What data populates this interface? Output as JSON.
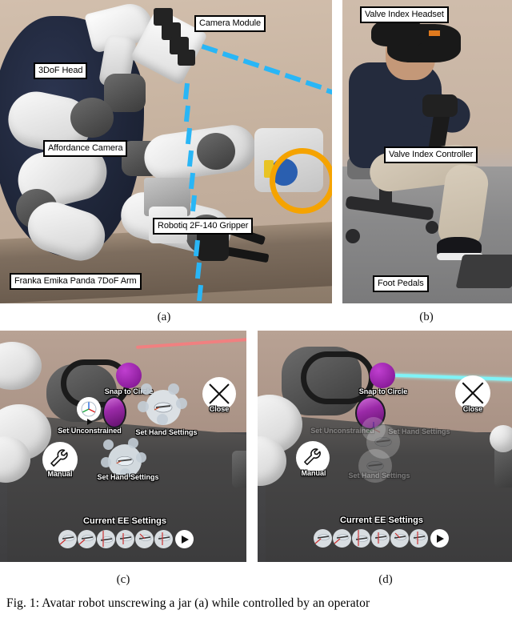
{
  "figure": {
    "caption": "Fig. 1: Avatar robot unscrewing a jar (a) while controlled by an operator",
    "subcaptions": [
      "(a)",
      "(b)",
      "(c)",
      "(d)"
    ]
  },
  "panel_a": {
    "name": "avatar-robot-hardware-photo",
    "annotations": [
      {
        "id": "camera-module",
        "text": "Camera Module"
      },
      {
        "id": "3dof-head",
        "text": "3DoF Head"
      },
      {
        "id": "affordance-camera",
        "text": "Affordance Camera"
      },
      {
        "id": "robotiq-gripper",
        "text": "Robotiq 2F-140 Gripper"
      },
      {
        "id": "franka-arm",
        "text": "Franka Emika Panda 7DoF Arm"
      }
    ],
    "highlight_color": "#f5a300",
    "guide_color": "#29b6f6"
  },
  "panel_b": {
    "name": "operator-station-photo",
    "annotations": [
      {
        "id": "valve-index-headset",
        "text": "Valve Index Headset"
      },
      {
        "id": "valve-index-controller",
        "text": "Valve Index Controller"
      },
      {
        "id": "foot-pedals",
        "text": "Foot Pedals"
      }
    ]
  },
  "panel_c": {
    "name": "vr-radial-menu-open",
    "menu_items": [
      {
        "id": "snap-to-circle",
        "label": "Snap to Circle",
        "icon": "magenta-sphere-icon",
        "state": "active"
      },
      {
        "id": "set-unconstrained",
        "label": "Set Unconstrained",
        "icon": "axes-gizmo-icon",
        "state": "active"
      },
      {
        "id": "set-hand-settings-right",
        "label": "Set Hand Settings",
        "icon": "hand-settings-wheel-icon",
        "state": "active"
      },
      {
        "id": "set-hand-settings-left",
        "label": "Set Hand Settings",
        "icon": "hand-settings-wheel-icon",
        "state": "active"
      },
      {
        "id": "manual",
        "label": "Manual",
        "icon": "wrench-icon",
        "state": "active"
      },
      {
        "id": "close",
        "label": "Close",
        "icon": "close-x-icon",
        "state": "active"
      }
    ],
    "ee_settings": {
      "title": "Current EE Settings",
      "icons": [
        "ee-pose-icon-1",
        "ee-pose-icon-2",
        "ee-pose-icon-3",
        "ee-pose-icon-4",
        "ee-pose-icon-5",
        "ee-pose-icon-6"
      ],
      "next_button": "play-next-icon"
    },
    "ray_color": "#f08080"
  },
  "panel_d": {
    "name": "vr-radial-menu-selected",
    "menu_items": [
      {
        "id": "snap-to-circle",
        "label": "Snap to Circle",
        "icon": "magenta-sphere-icon",
        "state": "active"
      },
      {
        "id": "set-unconstrained",
        "label": "Set Unconstrained",
        "icon": "axes-gizmo-icon",
        "state": "faded"
      },
      {
        "id": "set-hand-settings-right",
        "label": "Set Hand Settings",
        "icon": "hand-settings-wheel-icon",
        "state": "faded"
      },
      {
        "id": "set-hand-settings-left",
        "label": "Set Hand Settings",
        "icon": "hand-settings-wheel-icon",
        "state": "faded"
      },
      {
        "id": "manual",
        "label": "Manual",
        "icon": "wrench-icon",
        "state": "active"
      },
      {
        "id": "close",
        "label": "Close",
        "icon": "close-x-icon",
        "state": "active"
      }
    ],
    "ee_settings": {
      "title": "Current EE Settings",
      "icons": [
        "ee-pose-icon-1",
        "ee-pose-icon-2",
        "ee-pose-icon-3",
        "ee-pose-icon-4",
        "ee-pose-icon-5",
        "ee-pose-icon-6"
      ],
      "next_button": "play-next-icon"
    },
    "ray_color": "#7ff3f7"
  }
}
